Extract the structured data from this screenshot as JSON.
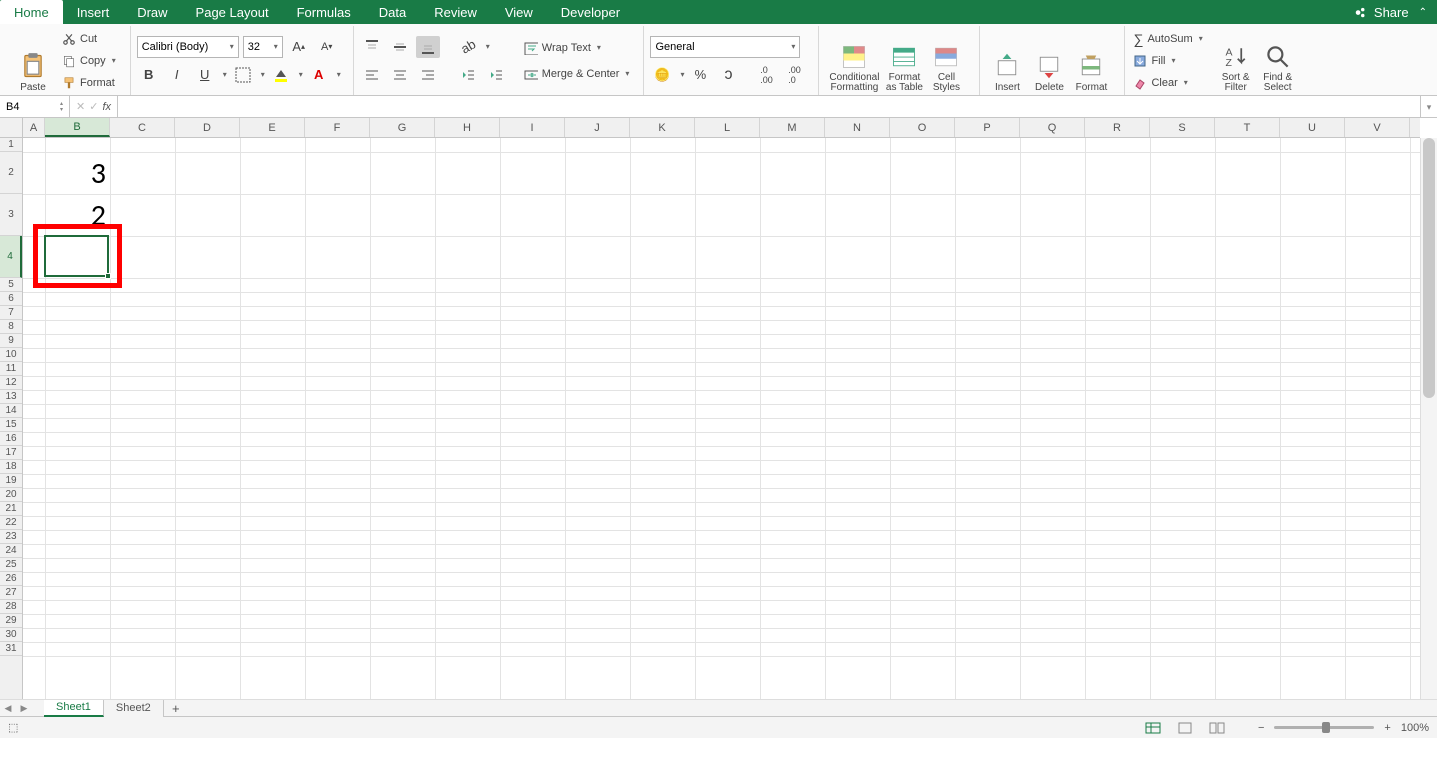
{
  "tabs": [
    "Home",
    "Insert",
    "Draw",
    "Page Layout",
    "Formulas",
    "Data",
    "Review",
    "View",
    "Developer"
  ],
  "active_tab": 0,
  "share_label": "Share",
  "clipboard": {
    "paste": "Paste",
    "cut": "Cut",
    "copy": "Copy",
    "format": "Format"
  },
  "font": {
    "name": "Calibri (Body)",
    "size": "32",
    "bold": "B",
    "italic": "I",
    "underline": "U"
  },
  "alignment": {
    "wrap": "Wrap Text",
    "merge": "Merge & Center"
  },
  "number": {
    "format": "General"
  },
  "styles": {
    "cond": "Conditional Formatting",
    "table": "Format as Table",
    "cell": "Cell Styles"
  },
  "cells_group": {
    "insert": "Insert",
    "delete": "Delete",
    "format": "Format"
  },
  "editing": {
    "autosum": "AutoSum",
    "fill": "Fill",
    "clear": "Clear",
    "sort": "Sort & Filter",
    "find": "Find & Select"
  },
  "name_box": "B4",
  "formula": "",
  "columns": [
    "A",
    "B",
    "C",
    "D",
    "E",
    "F",
    "G",
    "H",
    "I",
    "J",
    "K",
    "L",
    "M",
    "N",
    "O",
    "P",
    "Q",
    "R",
    "S",
    "T",
    "U",
    "V"
  ],
  "selected_col_idx": 1,
  "rows": 31,
  "tall_rows": [
    2,
    3,
    4
  ],
  "selected_row": 4,
  "cell_values": {
    "B2": "3",
    "B3": "2"
  },
  "selection": {
    "col": 1,
    "row": 4
  },
  "sheets": [
    "Sheet1",
    "Sheet2"
  ],
  "active_sheet": 0,
  "zoom": "100%"
}
